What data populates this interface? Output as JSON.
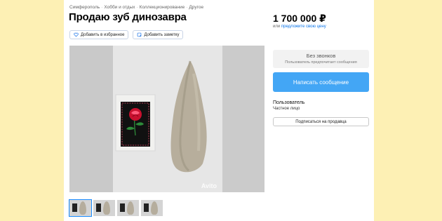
{
  "breadcrumbs": [
    "Симферополь",
    "Хобби и отдых",
    "Коллекционирование",
    "Другое"
  ],
  "title": "Продаю зуб динозавра",
  "actions": {
    "favorite_label": "Добавить в избранное",
    "note_label": "Добавить заметку"
  },
  "price": {
    "value": "1 700 000 ₽",
    "or_text": "или ",
    "offer_link": "предложите свою цену"
  },
  "no_calls": {
    "title": "Без звонков",
    "subtitle": "Пользователь предпочитает сообщения"
  },
  "message_button": "Написать сообщение",
  "seller": {
    "name": "Пользователь",
    "type": "Частное лицо",
    "subscribe_label": "Подписаться на продавца"
  },
  "gallery": {
    "watermark": "Avito",
    "thumbnail_count": 4,
    "active_thumbnail": 1
  }
}
